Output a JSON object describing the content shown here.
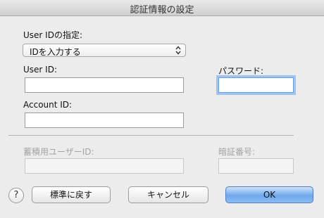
{
  "window": {
    "title": "認証情報の設定"
  },
  "fields": {
    "user_id_setting_label": "User IDの指定:",
    "user_id_setting_value": "IDを入力する",
    "user_id_label": "User ID:",
    "user_id_value": "",
    "password_label": "パスワード:",
    "password_value": "",
    "account_id_label": "Account ID:",
    "account_id_value": "",
    "stored_user_id_label": "蓄積用ユーザーID:",
    "stored_user_id_value": "",
    "pin_label": "暗証番号:",
    "pin_value": ""
  },
  "buttons": {
    "help": "?",
    "restore_default": "標準に戻す",
    "cancel": "キャンセル",
    "ok": "OK"
  },
  "icons": {
    "select_arrows": "up-down-chevrons-icon",
    "help": "question-mark-icon"
  },
  "colors": {
    "focus_ring": "#9fc4f2",
    "primary_button": "#6ea7ec",
    "disabled_text": "#a4a4a4"
  }
}
